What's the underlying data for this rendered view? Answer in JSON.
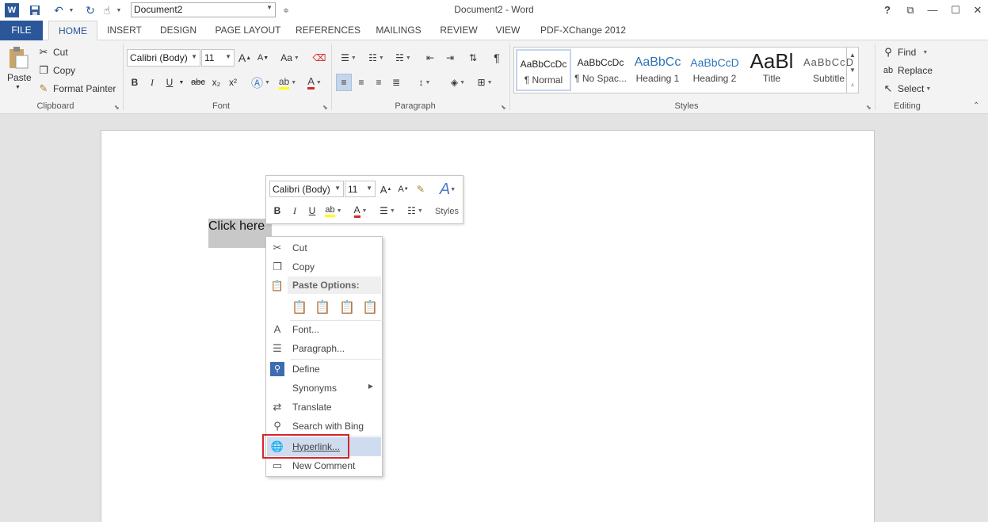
{
  "titlebar": {
    "doc_combo_value": "Document2",
    "window_title": "Document2 - Word",
    "help": "?",
    "controls": {
      "restore": "⧉",
      "minimize": "—",
      "maximize": "☐",
      "close": "✕"
    }
  },
  "tabs": [
    "FILE",
    "HOME",
    "INSERT",
    "DESIGN",
    "PAGE LAYOUT",
    "REFERENCES",
    "MAILINGS",
    "REVIEW",
    "VIEW",
    "PDF-XChange 2012"
  ],
  "active_tab": "HOME",
  "clipboard": {
    "paste": "Paste",
    "cut": "Cut",
    "copy": "Copy",
    "format_painter": "Format Painter",
    "label": "Clipboard"
  },
  "font": {
    "family": "Calibri (Body)",
    "size": "11",
    "bold": "B",
    "italic": "I",
    "underline": "U",
    "strike": "abc",
    "subscript": "x₂",
    "superscript": "x²",
    "grow": "A",
    "shrink": "A",
    "case": "Aa",
    "label": "Font"
  },
  "paragraph": {
    "label": "Paragraph"
  },
  "styles": {
    "items": [
      {
        "sample": "AaBbCcDc",
        "name": "¶ Normal"
      },
      {
        "sample": "AaBbCcDc",
        "name": "¶ No Spac..."
      },
      {
        "sample": "AaBbCc",
        "name": "Heading 1"
      },
      {
        "sample": "AaBbCcD",
        "name": "Heading 2"
      },
      {
        "sample": "AaBl",
        "name": "Title"
      },
      {
        "sample": "AaBbCcD",
        "name": "Subtitle"
      }
    ],
    "label": "Styles"
  },
  "editing": {
    "find": "Find",
    "replace": "Replace",
    "select": "Select",
    "label": "Editing"
  },
  "document": {
    "selected_text": "Click here"
  },
  "minitoolbar": {
    "font": "Calibri (Body)",
    "size": "11",
    "styles": "Styles"
  },
  "context_menu": {
    "cut": "Cut",
    "copy": "Copy",
    "paste_options": "Paste Options:",
    "font": "Font...",
    "paragraph": "Paragraph...",
    "define": "Define",
    "synonyms": "Synonyms",
    "translate": "Translate",
    "search_bing": "Search with Bing",
    "hyperlink": "Hyperlink...",
    "new_comment": "New Comment"
  },
  "colors": {
    "word_blue": "#2b579a",
    "highlight_red": "#d7262b",
    "menu_hover": "#cfdcef"
  }
}
